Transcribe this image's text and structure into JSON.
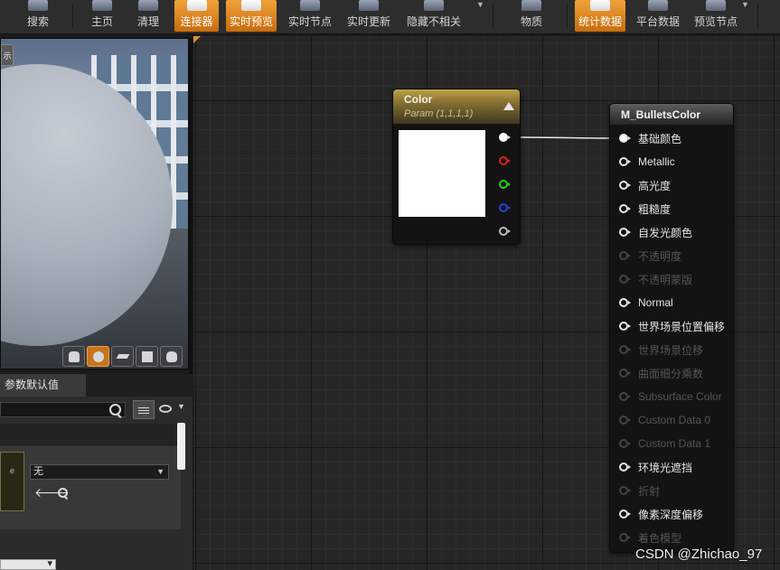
{
  "toolbar": {
    "items": [
      {
        "label": "搜索",
        "active": false,
        "icon": "search-icon"
      },
      {
        "label": "主页",
        "active": false,
        "icon": "home-icon"
      },
      {
        "label": "清理",
        "active": false,
        "icon": "clean-icon"
      },
      {
        "label": "连接器",
        "active": true,
        "icon": "connector-icon"
      },
      {
        "label": "实时预览",
        "active": true,
        "icon": "live-preview-icon"
      },
      {
        "label": "实时节点",
        "active": false,
        "icon": "live-nodes-icon"
      },
      {
        "label": "实时更新",
        "active": false,
        "icon": "live-update-icon"
      },
      {
        "label": "隐藏不相关",
        "active": false,
        "icon": "hide-unrelated-icon"
      },
      {
        "label": "物质",
        "active": false,
        "icon": "material-icon"
      },
      {
        "label": "统计数据",
        "active": true,
        "icon": "stats-icon"
      },
      {
        "label": "平台数据",
        "active": false,
        "icon": "platform-stats-icon"
      },
      {
        "label": "预览节点",
        "active": false,
        "icon": "preview-node-icon"
      }
    ]
  },
  "viewport": {
    "chip_label": "示"
  },
  "details_panel": {
    "tab_label": "参数默认值",
    "combo_value": "无",
    "thumb_label": "e"
  },
  "graph": {
    "color_node": {
      "title": "Color",
      "subtitle": "Param (1,1,1,1)",
      "swatch_color": "#ffffff",
      "outputs": [
        "rgba",
        "r",
        "g",
        "b",
        "a"
      ]
    },
    "material_node": {
      "title": "M_BulletsColor",
      "inputs": [
        {
          "label": "基础颜色",
          "enabled": true,
          "connected": true
        },
        {
          "label": "Metallic",
          "enabled": true,
          "connected": false
        },
        {
          "label": "高光度",
          "enabled": true,
          "connected": false
        },
        {
          "label": "粗糙度",
          "enabled": true,
          "connected": false
        },
        {
          "label": "自发光颜色",
          "enabled": true,
          "connected": false
        },
        {
          "label": "不透明度",
          "enabled": false,
          "connected": false
        },
        {
          "label": "不透明蒙版",
          "enabled": false,
          "connected": false
        },
        {
          "label": "Normal",
          "enabled": true,
          "connected": false
        },
        {
          "label": "世界场景位置偏移",
          "enabled": true,
          "connected": false
        },
        {
          "label": "世界场景位移",
          "enabled": false,
          "connected": false
        },
        {
          "label": "曲面细分乘数",
          "enabled": false,
          "connected": false
        },
        {
          "label": "Subsurface Color",
          "enabled": false,
          "connected": false
        },
        {
          "label": "Custom Data 0",
          "enabled": false,
          "connected": false
        },
        {
          "label": "Custom Data 1",
          "enabled": false,
          "connected": false
        },
        {
          "label": "环境光遮挡",
          "enabled": true,
          "connected": false
        },
        {
          "label": "折射",
          "enabled": false,
          "connected": false
        },
        {
          "label": "像素深度偏移",
          "enabled": true,
          "connected": false
        },
        {
          "label": "着色模型",
          "enabled": false,
          "connected": false
        }
      ]
    }
  },
  "watermark": "CSDN @Zhichao_97"
}
